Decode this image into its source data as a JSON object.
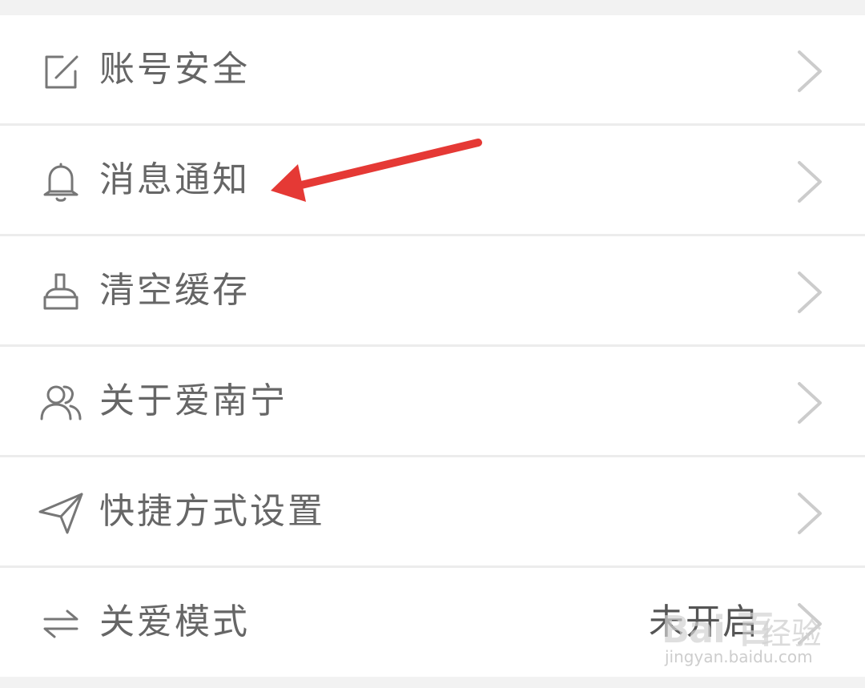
{
  "settings": {
    "items": [
      {
        "label": "账号安全",
        "icon": "edit-square-icon",
        "value": ""
      },
      {
        "label": "消息通知",
        "icon": "bell-icon",
        "value": ""
      },
      {
        "label": "清空缓存",
        "icon": "broom-icon",
        "value": ""
      },
      {
        "label": "关于爱南宁",
        "icon": "users-icon",
        "value": ""
      },
      {
        "label": "快捷方式设置",
        "icon": "paper-plane-icon",
        "value": ""
      },
      {
        "label": "关爱模式",
        "icon": "swap-arrows-icon",
        "value": "未开启"
      }
    ]
  },
  "annotation": {
    "color": "#e53935",
    "target": "消息通知"
  },
  "watermark": {
    "logo": "Bai 百",
    "brand": "经验",
    "url": "jingyan.baidu.com"
  },
  "colors": {
    "text": "#666666",
    "icon": "#777777",
    "chevron": "#cccccc",
    "background": "#f2f2f2",
    "divider": "#ececec"
  }
}
